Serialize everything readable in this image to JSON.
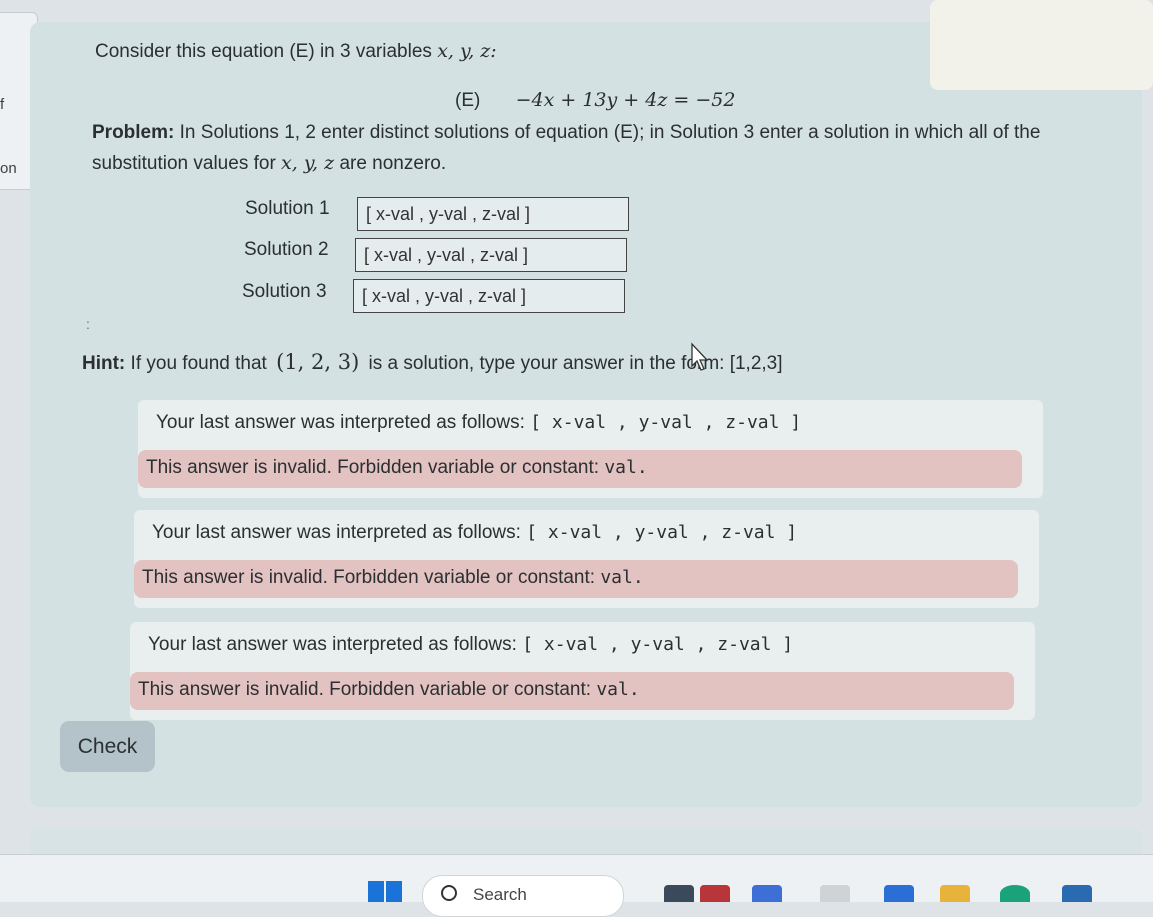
{
  "sidebar": {
    "fragment_top": "f",
    "fragment_bottom": "on"
  },
  "question": {
    "prompt": "Consider this equation (E) in 3 variables",
    "prompt_vars": "x, y, z:",
    "equation_label": "(E)",
    "equation": "−4x + 13y + 4z = −52",
    "problem_bold": "Problem:",
    "problem_part1": "In Solutions 1, 2 enter distinct solutions of equation (E); in Solution 3 enter a solution in which all of the substitution values for",
    "problem_vars": "x, y, z",
    "problem_part2": "are nonzero."
  },
  "solutions": [
    {
      "label": "Solution 1",
      "value": "",
      "placeholder": "[ x-val , y-val , z-val ]"
    },
    {
      "label": "Solution 2",
      "value": "",
      "placeholder": "[ x-val , y-val , z-val ]"
    },
    {
      "label": "Solution 3",
      "value": "",
      "placeholder": "[ x-val , y-val , z-val ]"
    }
  ],
  "hint": {
    "bold": "Hint:",
    "text_before": "If you found that",
    "example": "(1, 2, 3)",
    "text_after": "is a solution, type your answer in the form: [1,2,3]"
  },
  "feedback": [
    {
      "interp_label": "Your last answer was interpreted as follows:",
      "interp_value": "[ x-val , y-val , z-val ]",
      "error_text": "This answer is invalid. Forbidden variable or constant:",
      "error_code": "val."
    },
    {
      "interp_label": "Your last answer was interpreted as follows:",
      "interp_value": "[ x-val , y-val , z-val ]",
      "error_text": "This answer is invalid. Forbidden variable or constant:",
      "error_code": "val."
    },
    {
      "interp_label": "Your last answer was interpreted as follows:",
      "interp_value": "[ x-val , y-val , z-val ]",
      "error_text": "This answer is invalid. Forbidden variable or constant:",
      "error_code": "val."
    }
  ],
  "check_label": "Check",
  "taskbar": {
    "search_label": "Search"
  },
  "colors": {
    "panel_bg": "#d3e1e2",
    "error_bg": "#e3c2c2",
    "check_bg": "#b4c3c9",
    "windows_blue": "#1a73d9"
  }
}
